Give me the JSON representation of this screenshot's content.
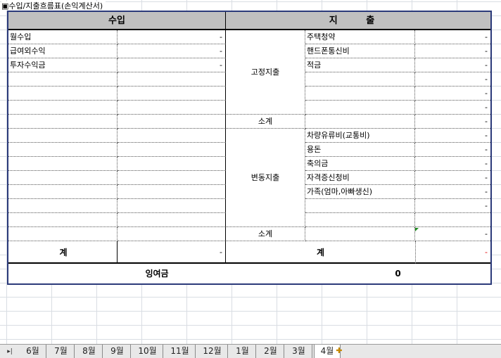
{
  "sheet_title": "▣수입/지출흐름표(손익계산서)",
  "header": {
    "income": "수입",
    "expense": "지  출"
  },
  "income_rows": [
    {
      "label": "월수입",
      "value": "-"
    },
    {
      "label": "급여외수익",
      "value": "-"
    },
    {
      "label": "투자수익금",
      "value": "-"
    },
    {
      "label": "",
      "value": ""
    },
    {
      "label": "",
      "value": ""
    },
    {
      "label": "",
      "value": ""
    },
    {
      "label": "",
      "value": ""
    },
    {
      "label": "",
      "value": ""
    },
    {
      "label": "",
      "value": ""
    },
    {
      "label": "",
      "value": ""
    },
    {
      "label": "",
      "value": ""
    },
    {
      "label": "",
      "value": ""
    },
    {
      "label": "",
      "value": ""
    },
    {
      "label": "",
      "value": ""
    },
    {
      "label": "",
      "value": ""
    }
  ],
  "expense_groups": {
    "fixed": {
      "category": "고정지출",
      "items": [
        {
          "label": "주택청약",
          "value": "-"
        },
        {
          "label": "핸드폰통신비",
          "value": "-"
        },
        {
          "label": "적금",
          "value": "-"
        },
        {
          "label": "",
          "value": "-"
        },
        {
          "label": "",
          "value": "-"
        },
        {
          "label": "",
          "value": "-"
        }
      ],
      "subtotal_label": "소계",
      "subtotal_value": "-"
    },
    "variable": {
      "category": "변동지출",
      "items": [
        {
          "label": "차량유류비(교통비)",
          "value": "-"
        },
        {
          "label": "용돈",
          "value": "-"
        },
        {
          "label": "축의금",
          "value": "-"
        },
        {
          "label": "자격증신청비",
          "value": "-"
        },
        {
          "label": "가족(엄마,아빠생신)",
          "value": "-"
        },
        {
          "label": "",
          "value": "-"
        },
        {
          "label": "",
          "value": ""
        }
      ],
      "subtotal_label": "소계",
      "subtotal_value": "-"
    }
  },
  "totals": {
    "income_label": "계",
    "income_value": "-",
    "expense_label": "계",
    "expense_value": "-",
    "expense_value_color": "#e00000"
  },
  "surplus": {
    "label": "잉여금",
    "value": "0"
  },
  "tabs": [
    "6월",
    "7월",
    "8월",
    "9월",
    "10월",
    "11월",
    "12월",
    "1월",
    "2월",
    "3월",
    "4월"
  ],
  "active_tab": "4월",
  "colors": {
    "border": "#2b3a7a",
    "header_bg": "#c0c0c0"
  }
}
